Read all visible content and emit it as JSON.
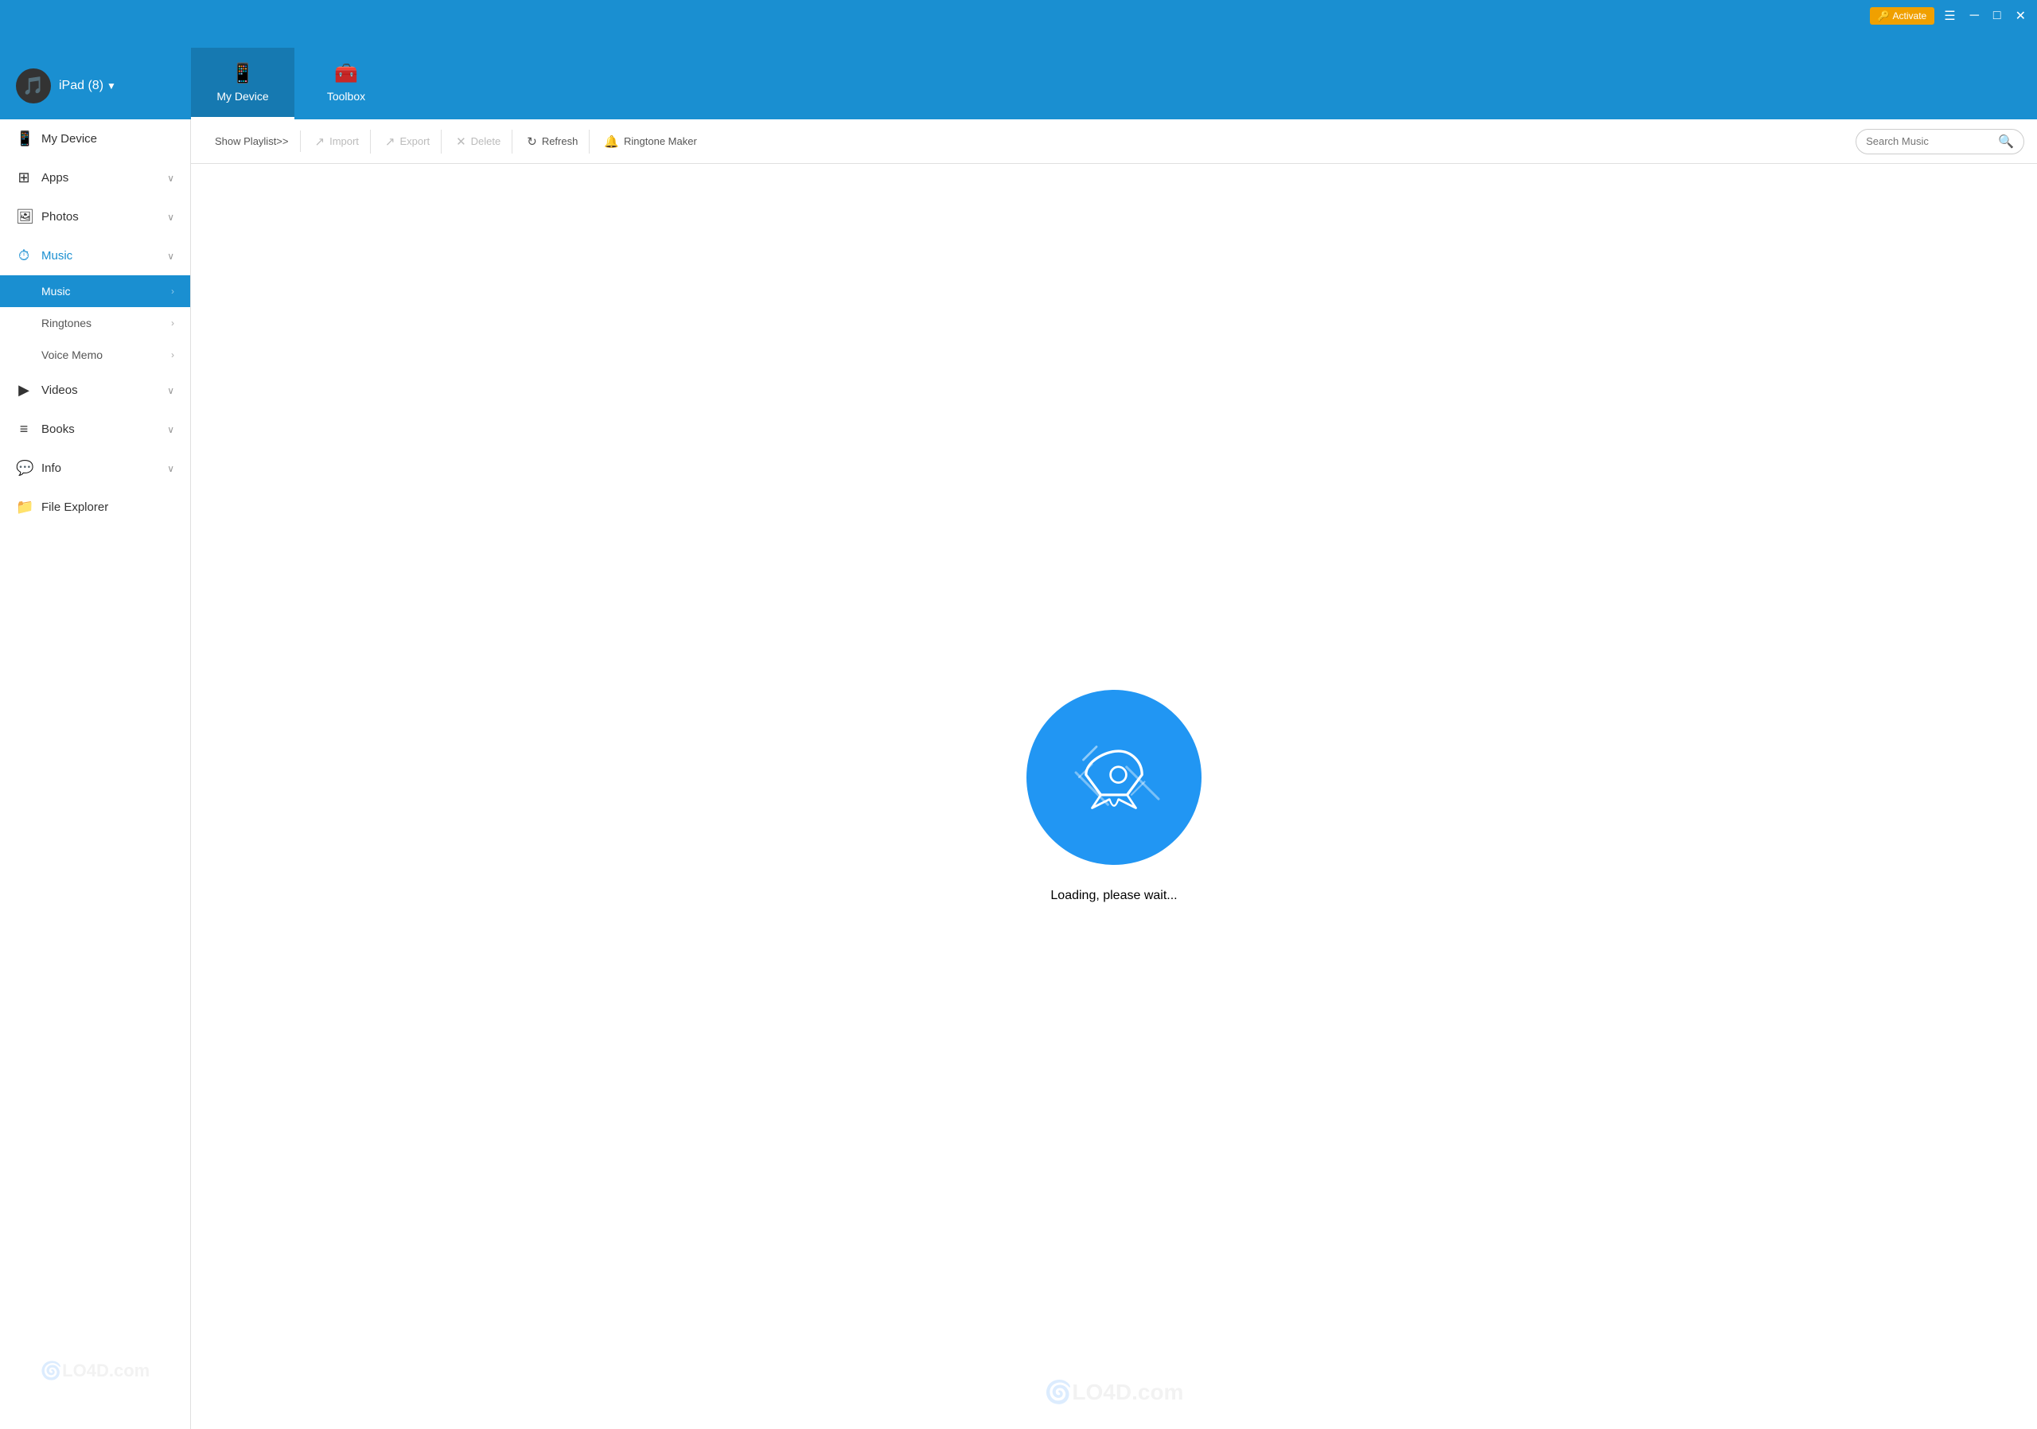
{
  "titlebar": {
    "activate_label": "Activate",
    "activate_icon": "🔑"
  },
  "navbar": {
    "device_name": "iPad (8)",
    "tabs": [
      {
        "id": "my-device",
        "label": "My Device",
        "icon": "📱",
        "active": true
      },
      {
        "id": "toolbox",
        "label": "Toolbox",
        "icon": "🧰",
        "active": false
      }
    ]
  },
  "sidebar": {
    "items": [
      {
        "id": "my-device",
        "label": "My Device",
        "icon": "📱",
        "has_chevron": false
      },
      {
        "id": "apps",
        "label": "Apps",
        "icon": "⊞",
        "has_chevron": true
      },
      {
        "id": "photos",
        "label": "Photos",
        "icon": "🖼",
        "has_chevron": true
      },
      {
        "id": "music",
        "label": "Music",
        "icon": "⏱",
        "has_chevron": true,
        "active": true,
        "children": [
          {
            "id": "music-sub",
            "label": "Music",
            "active": true
          },
          {
            "id": "ringtones",
            "label": "Ringtones",
            "active": false
          },
          {
            "id": "voice-memo",
            "label": "Voice Memo",
            "active": false
          }
        ]
      },
      {
        "id": "videos",
        "label": "Videos",
        "icon": "▶",
        "has_chevron": true
      },
      {
        "id": "books",
        "label": "Books",
        "icon": "≡",
        "has_chevron": true
      },
      {
        "id": "info",
        "label": "Info",
        "icon": "💬",
        "has_chevron": true
      },
      {
        "id": "file-explorer",
        "label": "File Explorer",
        "icon": "📁",
        "has_chevron": false
      }
    ]
  },
  "toolbar": {
    "show_playlist_label": "Show Playlist>>",
    "import_label": "Import",
    "export_label": "Export",
    "delete_label": "Delete",
    "refresh_label": "Refresh",
    "ringtone_maker_label": "Ringtone Maker",
    "search_placeholder": "Search Music"
  },
  "content": {
    "loading_text": "Loading, please wait..."
  }
}
